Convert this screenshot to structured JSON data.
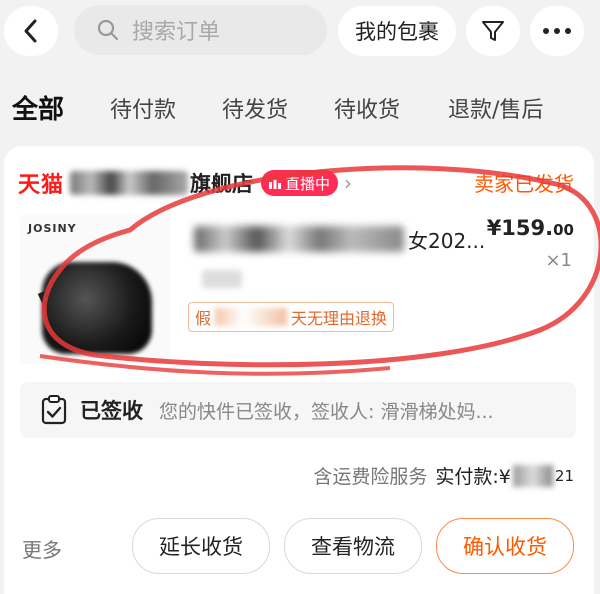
{
  "topbar": {
    "back_icon": "chevron-left-icon",
    "search_placeholder": "搜索订单",
    "search_icon": "search-icon",
    "packages_label": "我的包裹",
    "filter_icon": "filter-icon",
    "more_icon": "more-dots-icon"
  },
  "tabs": [
    {
      "label": "全部",
      "active": true
    },
    {
      "label": "待付款"
    },
    {
      "label": "待发货"
    },
    {
      "label": "待收货"
    },
    {
      "label": "退款/售后"
    }
  ],
  "order": {
    "platform": "天猫",
    "shop_name_suffix": "旗舰店",
    "live_badge": "直播中",
    "status": "卖家已发货",
    "product": {
      "brand": "JOSINY",
      "title_tail": "女202...",
      "price_main": "¥159.",
      "price_cents": "00",
      "quantity": "×1",
      "policy_prefix": "假",
      "policy_suffix": "天无理由退换"
    },
    "logistics": {
      "status": "已签收",
      "detail": "您的快件已签收，签收人: 滑滑梯处妈...",
      "icon": "clipboard-check-icon"
    },
    "payment": {
      "insurance": "含运费险服务",
      "paid_label": "实付款:¥",
      "paid_tail": "21"
    },
    "actions": {
      "more": "更多",
      "extend": "延长收货",
      "logistics": "查看物流",
      "confirm": "确认收货"
    }
  },
  "colors": {
    "accent": "#ff5a00",
    "tmall_red": "#ff1a1a",
    "live_pink": "#ff2d55",
    "annotation": "#e83a3a"
  }
}
